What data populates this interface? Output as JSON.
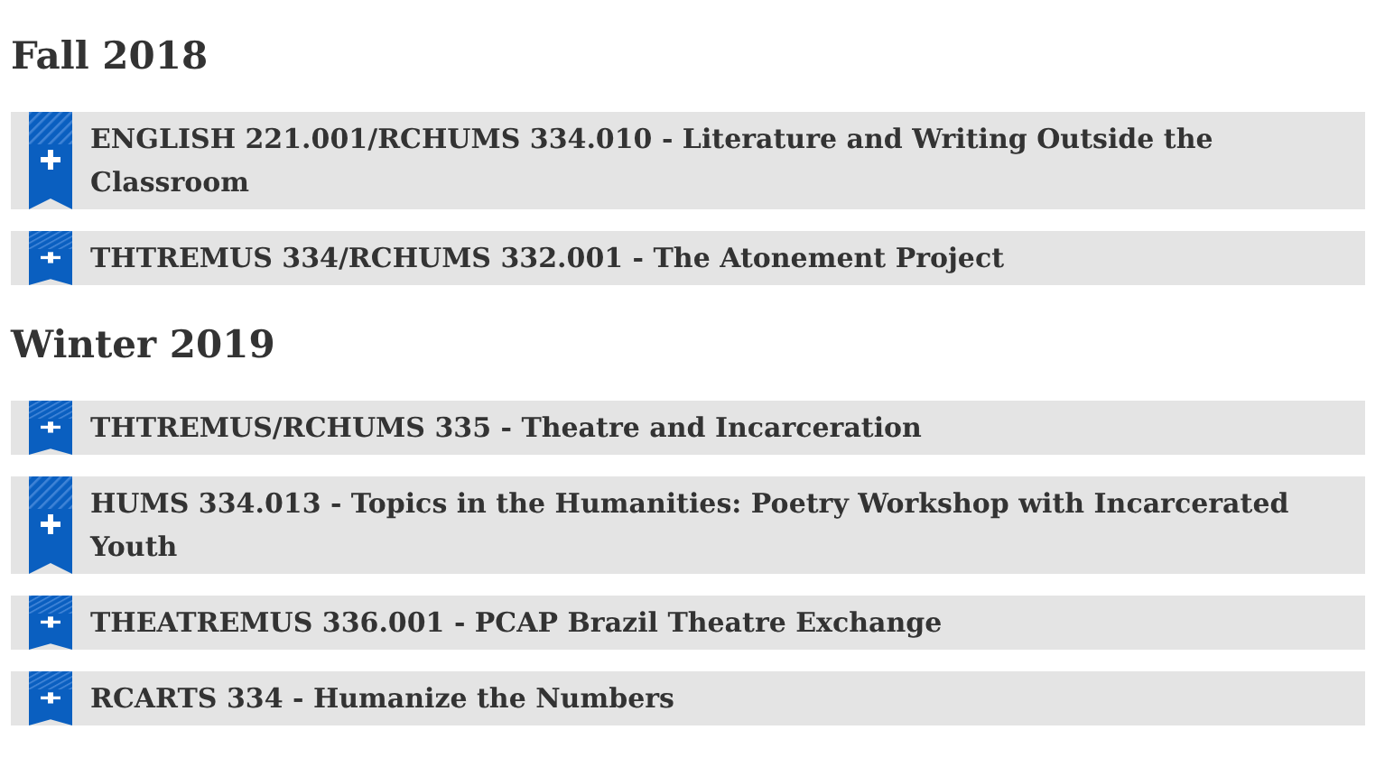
{
  "sections": [
    {
      "heading": "Fall 2018",
      "items": [
        {
          "title": "ENGLISH 221.001/RCHUMS 334.010 - Literature and Writing Outside the Classroom",
          "expanded": false
        },
        {
          "title": "THTREMUS 334/RCHUMS 332.001 - The Atonement Project",
          "expanded": false
        }
      ]
    },
    {
      "heading": "Winter 2019",
      "items": [
        {
          "title": "THTREMUS/RCHUMS 335 - Theatre and Incarceration",
          "expanded": false
        },
        {
          "title": "HUMS 334.013 - Topics in the Humanities: Poetry Workshop with Incarcerated Youth",
          "expanded": false
        },
        {
          "title": "THEATREMUS 336.001 - PCAP Brazil Theatre Exchange",
          "expanded": false
        },
        {
          "title": "RCARTS 334 - Humanize the Numbers",
          "expanded": false
        }
      ]
    }
  ]
}
